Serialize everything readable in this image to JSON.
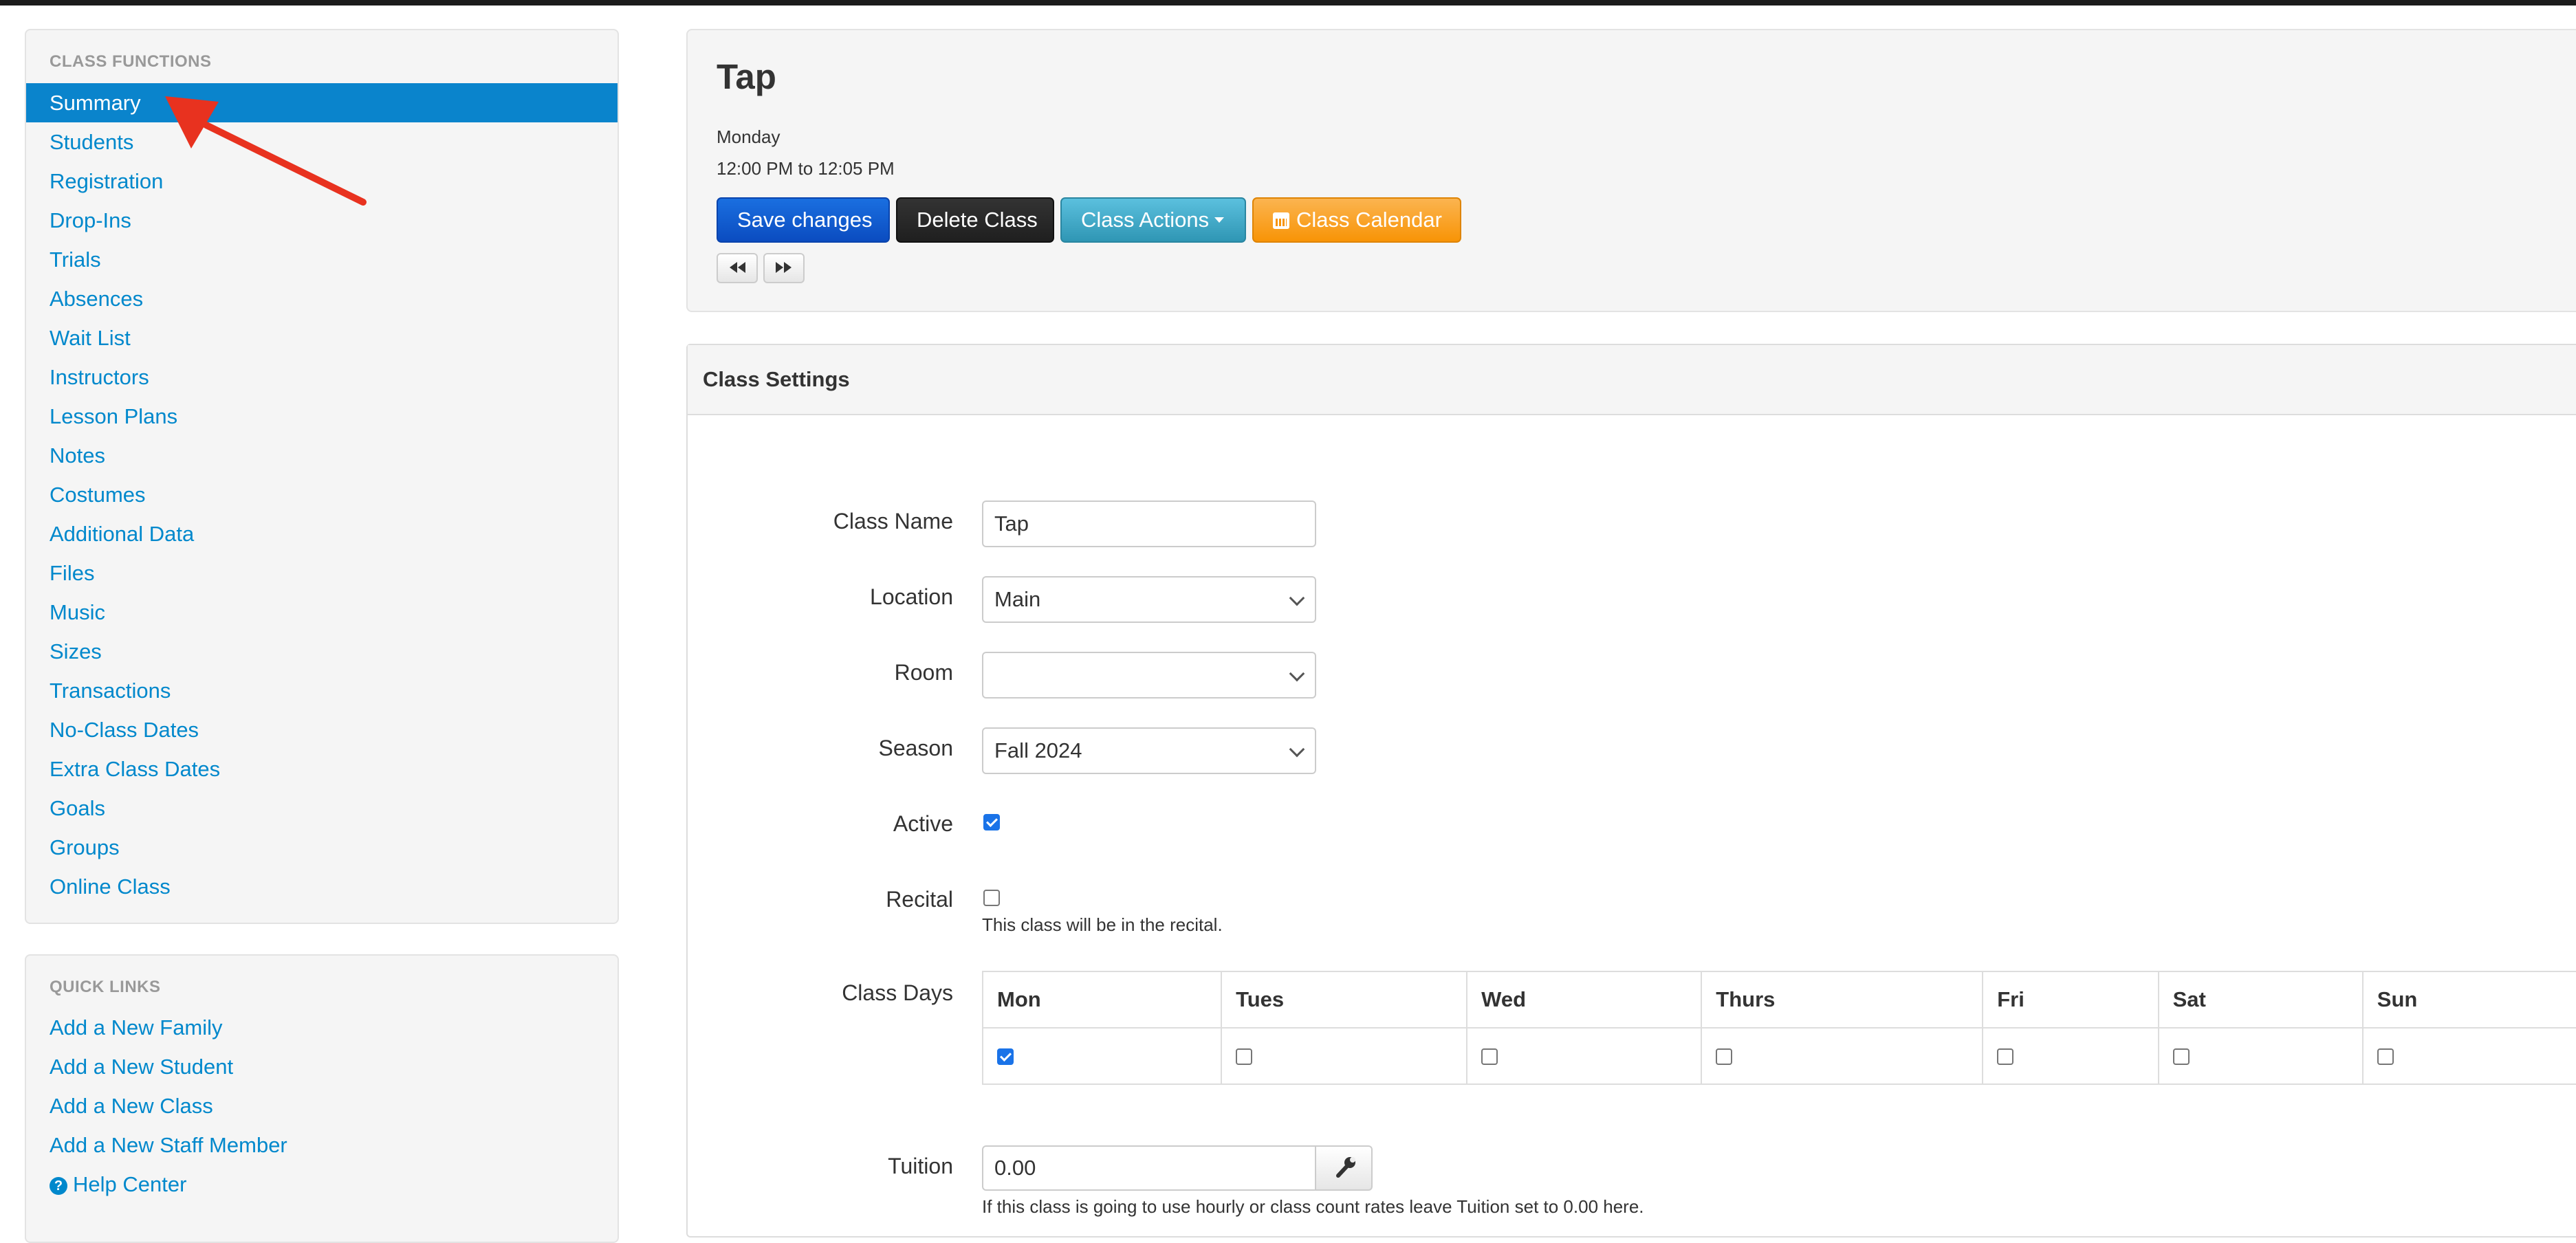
{
  "sidebar": {
    "functions_header": "CLASS FUNCTIONS",
    "functions": [
      {
        "label": "Summary",
        "active": true
      },
      {
        "label": "Students"
      },
      {
        "label": "Registration"
      },
      {
        "label": "Drop-Ins"
      },
      {
        "label": "Trials"
      },
      {
        "label": "Absences"
      },
      {
        "label": "Wait List"
      },
      {
        "label": "Instructors"
      },
      {
        "label": "Lesson Plans"
      },
      {
        "label": "Notes"
      },
      {
        "label": "Costumes"
      },
      {
        "label": "Additional Data"
      },
      {
        "label": "Files"
      },
      {
        "label": "Music"
      },
      {
        "label": "Sizes"
      },
      {
        "label": "Transactions"
      },
      {
        "label": "No-Class Dates"
      },
      {
        "label": "Extra Class Dates"
      },
      {
        "label": "Goals"
      },
      {
        "label": "Groups"
      },
      {
        "label": "Online Class"
      }
    ],
    "links_header": "QUICK LINKS",
    "links": [
      {
        "label": "Add a New Family"
      },
      {
        "label": "Add a New Student"
      },
      {
        "label": "Add a New Class"
      },
      {
        "label": "Add a New Staff Member"
      },
      {
        "label": "Help Center",
        "icon": "question-circle-icon"
      }
    ]
  },
  "header": {
    "title": "Tap",
    "day": "Monday",
    "time": "12:00 PM to 12:05 PM",
    "buttons": {
      "save": "Save changes",
      "delete": "Delete Class",
      "actions": "Class Actions",
      "calendar": "Class Calendar"
    },
    "nav_icons": {
      "prev": "backward-icon",
      "next": "forward-icon"
    }
  },
  "settings": {
    "heading": "Class Settings",
    "class_name": {
      "label": "Class Name",
      "value": "Tap"
    },
    "location": {
      "label": "Location",
      "value": "Main"
    },
    "room": {
      "label": "Room",
      "value": ""
    },
    "season": {
      "label": "Season",
      "value": "Fall 2024"
    },
    "active": {
      "label": "Active",
      "checked": true
    },
    "recital": {
      "label": "Recital",
      "checked": false,
      "help": "This class will be in the recital."
    },
    "class_days": {
      "label": "Class Days",
      "days": [
        {
          "name": "Mon",
          "checked": true
        },
        {
          "name": "Tues",
          "checked": false
        },
        {
          "name": "Wed",
          "checked": false
        },
        {
          "name": "Thurs",
          "checked": false
        },
        {
          "name": "Fri",
          "checked": false
        },
        {
          "name": "Sat",
          "checked": false
        },
        {
          "name": "Sun",
          "checked": false
        }
      ]
    },
    "tuition": {
      "label": "Tuition",
      "value": "0.00",
      "help": "If this class is going to use hourly or class count rates leave Tuition set to 0.00 here."
    }
  },
  "colors": {
    "link": "#0088cc",
    "active_bg": "#0a84cc",
    "primary": "#0b4cc0",
    "inverse": "#222222",
    "info": "#2f96b4",
    "warning": "#f89406",
    "annotation_arrow": "#e8321f"
  }
}
